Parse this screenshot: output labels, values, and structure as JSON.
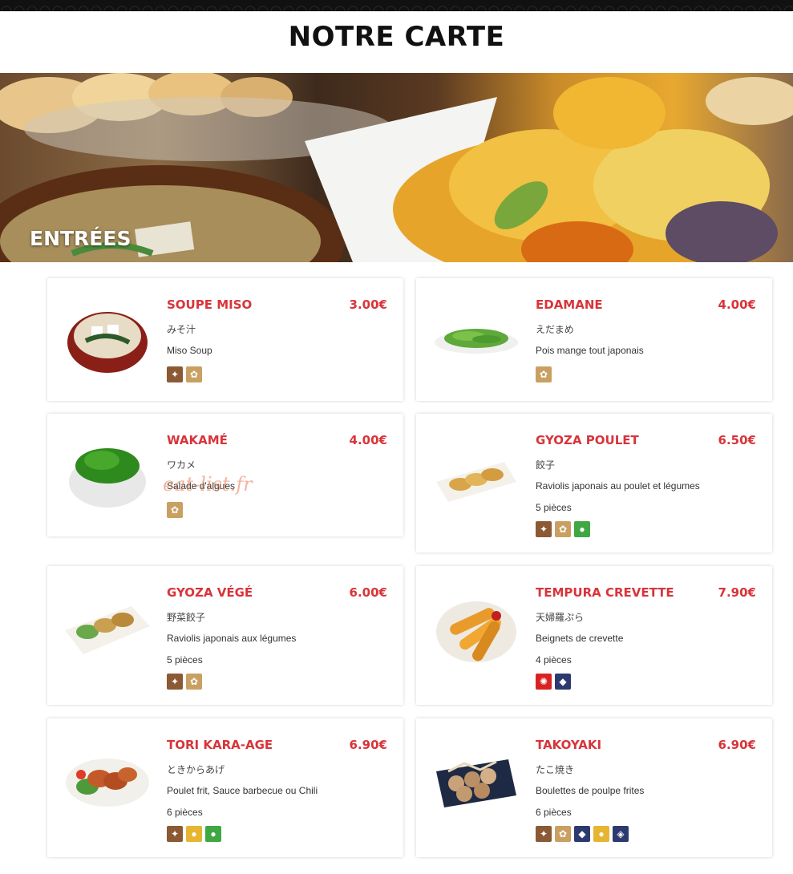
{
  "page_title": "NOTRE CARTE",
  "section_title": "ENTRÉES",
  "watermark": "eat-list.fr",
  "icons_legend": {
    "gluten": "wheat-icon",
    "soy": "soy-icon",
    "egg": "egg-icon",
    "vegetarian": "vegetarian-icon",
    "crustacean": "crab-icon",
    "fish": "fish-icon",
    "shellfish": "shell-icon"
  },
  "colors": {
    "accent": "#d8343a",
    "gluten": "#8b5a35",
    "soy": "#c9a062",
    "egg": "#e6b531",
    "vegetarian": "#3fa843",
    "seafood": "#2d3a6f",
    "crustacean": "#d82323"
  },
  "items": [
    {
      "name": "SOUPE MISO",
      "price": "3.00€",
      "jp": "みそ汁",
      "desc": "Miso Soup",
      "pieces": "",
      "icons": [
        "gluten",
        "soy"
      ]
    },
    {
      "name": "EDAMANE",
      "price": "4.00€",
      "jp": "えだまめ",
      "desc": "Pois mange tout japonais",
      "pieces": "",
      "icons": [
        "soy"
      ]
    },
    {
      "name": "WAKAMÉ",
      "price": "4.00€",
      "jp": "ワカメ",
      "desc": "Salade d'algues",
      "pieces": "",
      "icons": [
        "soy"
      ]
    },
    {
      "name": "GYOZA POULET",
      "price": "6.50€",
      "jp": "餃子",
      "desc": "Raviolis japonais au poulet et légumes",
      "pieces": "5 pièces",
      "icons": [
        "gluten",
        "soy",
        "vegetarian"
      ]
    },
    {
      "name": "GYOZA VÉGÉ",
      "price": "6.00€",
      "jp": "野菜餃子",
      "desc": "Raviolis japonais aux légumes",
      "pieces": "5 pièces",
      "icons": [
        "gluten",
        "soy"
      ]
    },
    {
      "name": "TEMPURA CREVETTE",
      "price": "7.90€",
      "jp": "天婦羅ぷら",
      "desc": "Beignets de crevette",
      "pieces": "4 pièces",
      "icons": [
        "crustacean",
        "fish"
      ]
    },
    {
      "name": "TORI KARA-AGE",
      "price": "6.90€",
      "jp": "ときからあげ",
      "desc": "Poulet frit, Sauce barbecue ou Chili",
      "pieces": "6 pièces",
      "icons": [
        "gluten",
        "egg",
        "vegetarian"
      ]
    },
    {
      "name": "TAKOYAKI",
      "price": "6.90€",
      "jp": "たこ焼き",
      "desc": "Boulettes de poulpe frites",
      "pieces": "6 pièces",
      "icons": [
        "gluten",
        "soy",
        "fish",
        "egg",
        "shellfish"
      ]
    }
  ]
}
